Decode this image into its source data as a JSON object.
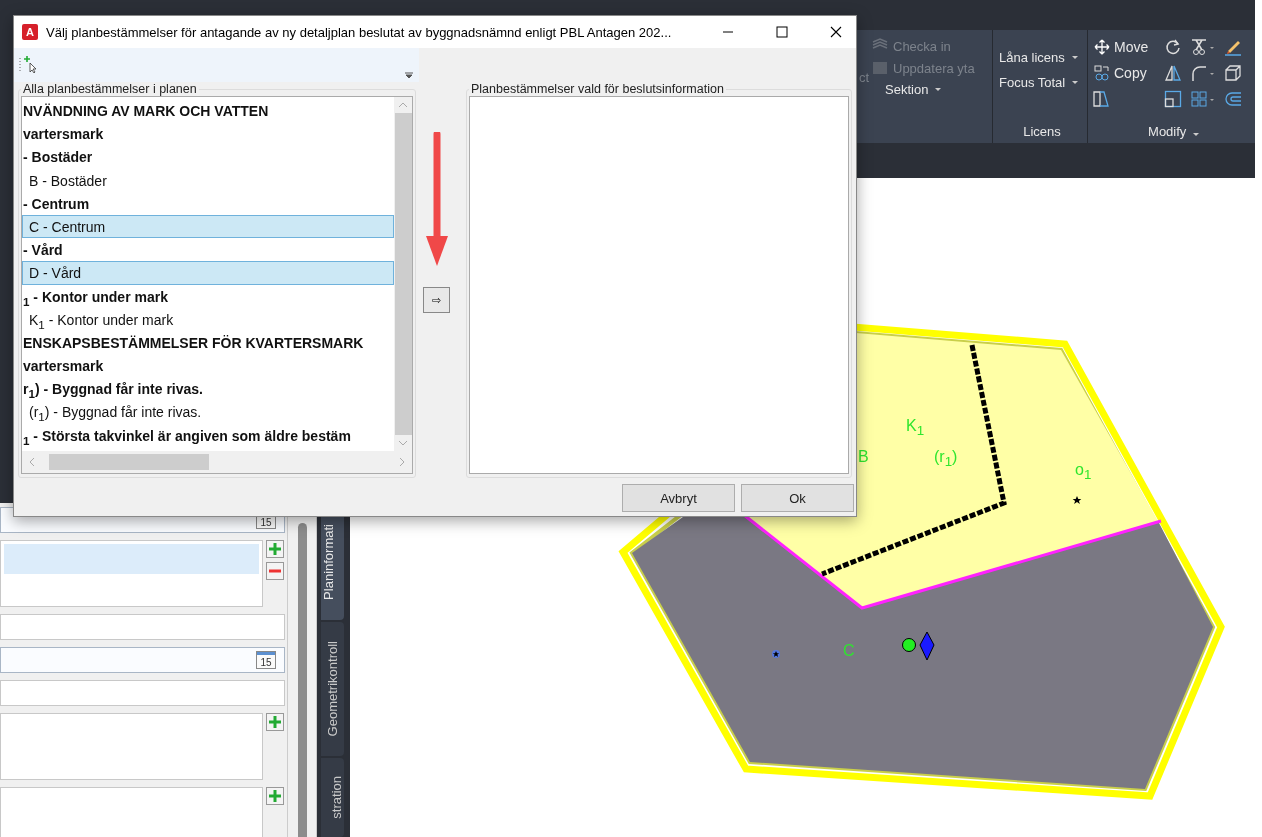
{
  "ribbon": {
    "cut_label": "ct",
    "project_buttons": [
      {
        "label": "Checka in",
        "disabled": true,
        "dropdown": false
      },
      {
        "label": "Uppdatera yta",
        "disabled": true,
        "dropdown": false
      },
      {
        "label": "Sektion",
        "disabled": false,
        "dropdown": true
      }
    ],
    "licens": {
      "buttons": [
        {
          "label": "Låna licens",
          "dropdown": true
        },
        {
          "label": "Focus Total",
          "dropdown": true
        }
      ],
      "title": "Licens"
    },
    "modify": {
      "buttons": [
        {
          "label": "Move"
        },
        {
          "label": "Copy"
        }
      ],
      "title": "Modify"
    }
  },
  "side_panel": {
    "fields": [
      {
        "kind": "date",
        "calendar_day": "15"
      },
      {
        "kind": "list",
        "rows": [
          {
            "selected": true
          },
          {
            "selected": false
          }
        ],
        "buttons": [
          {
            "kind": "add"
          },
          {
            "kind": "remove"
          }
        ]
      },
      {
        "kind": "text"
      },
      {
        "kind": "date",
        "calendar_day": "15"
      },
      {
        "kind": "text"
      },
      {
        "kind": "list",
        "buttons": [
          {
            "kind": "add"
          }
        ]
      },
      {
        "kind": "list",
        "buttons": [
          {
            "kind": "add"
          }
        ]
      }
    ],
    "tabs": [
      {
        "label": "Planinformati",
        "selected": true
      },
      {
        "label": "Geometrikontroll",
        "selected": false
      },
      {
        "label": "stration",
        "selected": false
      }
    ]
  },
  "drawing": {
    "labels": [
      {
        "text": "K$_{1}$"
      },
      {
        "text": "B"
      },
      {
        "text": "(r$_{1}$)"
      },
      {
        "text": "o$_{1}$"
      },
      {
        "text": "C"
      }
    ]
  },
  "dialog": {
    "app_icon_letter": "A",
    "title": "Välj planbestämmelser för antagande av ny detaljplan beslutat av byggnadsnämnd enligt PBL Antagen 202...",
    "left_group": {
      "title": "Alla planbestämmelser i planen",
      "rows": [
        {
          "kind": "heading",
          "text": "NVÄNDNING AV MARK OCH VATTEN",
          "selected": false
        },
        {
          "kind": "heading",
          "text": "vartersmark",
          "selected": false
        },
        {
          "kind": "heading",
          "text": "- Bostäder",
          "selected": false
        },
        {
          "kind": "item",
          "text": "B - Bostäder",
          "selected": false
        },
        {
          "kind": "heading",
          "text": "- Centrum",
          "selected": false
        },
        {
          "kind": "item",
          "text": "C - Centrum",
          "selected": true
        },
        {
          "kind": "heading",
          "text": "- Vård",
          "selected": false
        },
        {
          "kind": "item",
          "text": "D - Vård",
          "selected": true
        },
        {
          "kind": "heading",
          "text": "$_{1}$ - Kontor under mark",
          "selected": false
        },
        {
          "kind": "item",
          "text": "K$_{1}$ - Kontor under mark",
          "selected": false
        },
        {
          "kind": "heading",
          "text": "ENSKAPSBESTÄMMELSER FÖR KVARTERSMARK",
          "selected": false
        },
        {
          "kind": "heading",
          "text": "vartersmark",
          "selected": false
        },
        {
          "kind": "heading",
          "text": "r$_{1}$) - Byggnad får inte rivas.",
          "selected": false
        },
        {
          "kind": "item",
          "text": "(r$_{1}$) - Byggnad får inte rivas.",
          "selected": false
        },
        {
          "kind": "heading",
          "text": "$_{1}$ - Största takvinkel är angiven som äldre bestäm",
          "selected": false
        }
      ]
    },
    "move_button": "⇨",
    "right_group": {
      "title": "Planbestämmelser vald för beslutsinformation"
    },
    "buttons": [
      "Avbryt",
      "Ok"
    ]
  }
}
